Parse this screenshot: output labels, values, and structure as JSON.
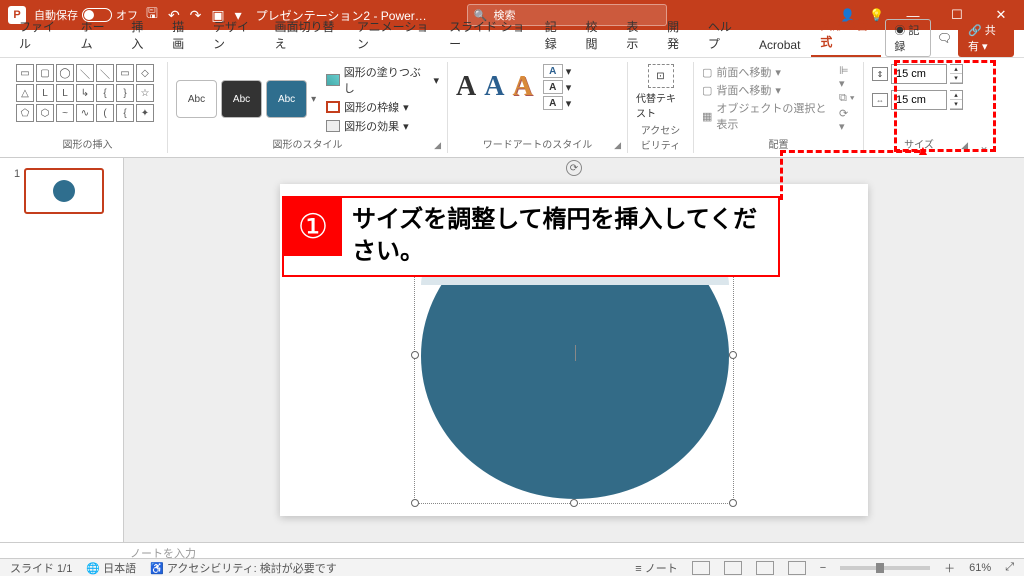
{
  "titlebar": {
    "autosave_label": "自動保存",
    "autosave_state": "オフ",
    "doc_title": "プレゼンテーション2 - Power…",
    "search_placeholder": "検索"
  },
  "tabs": {
    "items": [
      "ファイル",
      "ホーム",
      "挿入",
      "描画",
      "デザイン",
      "画面切り替え",
      "アニメーション",
      "スライド ショー",
      "記録",
      "校閲",
      "表示",
      "開発",
      "ヘルプ",
      "Acrobat",
      "図形の書式"
    ],
    "active": "図形の書式",
    "record": "記録",
    "share": "共有"
  },
  "ribbon": {
    "groups": {
      "insert_shapes": "図形の挿入",
      "shape_styles": "図形のスタイル",
      "shape_fill": "図形の塗りつぶし",
      "shape_outline": "図形の枠線",
      "shape_effects": "図形の効果",
      "wordart_styles": "ワードアートのスタイル",
      "accessibility": "アクセシビリティ",
      "alt_text": "代替テキスト",
      "arrange": "配置",
      "bring_forward": "前面へ移動",
      "send_backward": "背面へ移動",
      "selection_pane": "オブジェクトの選択と表示",
      "size": "サイズ"
    },
    "style_label": "Abc",
    "size_height": "15 cm",
    "size_width": "15 cm"
  },
  "callout": {
    "badge": "①",
    "text": "サイズを調整して楕円を挿入してください。"
  },
  "notes_placeholder": "ノートを入力",
  "status": {
    "slide": "スライド 1/1",
    "lang": "日本語",
    "a11y": "アクセシビリティ: 検討が必要です",
    "notes_btn": "ノート",
    "zoom": "61%"
  },
  "thumbs": {
    "num": "1"
  }
}
